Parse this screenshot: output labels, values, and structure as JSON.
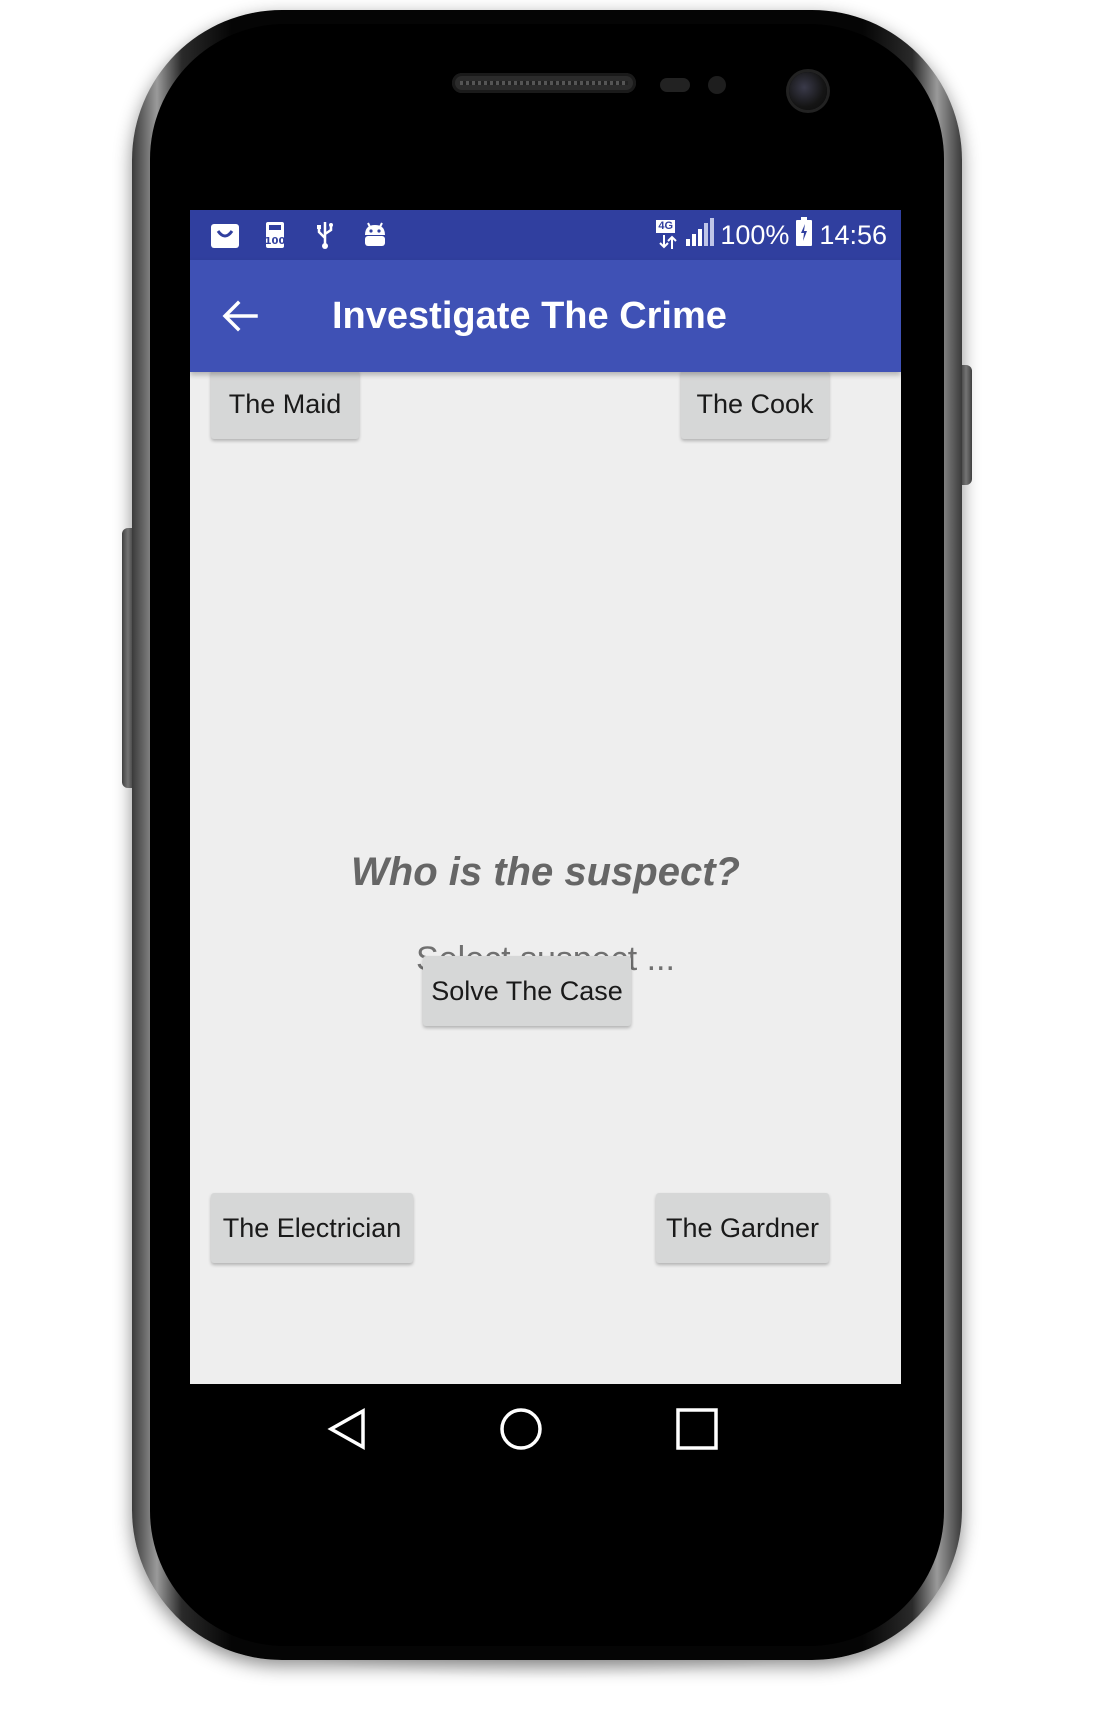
{
  "status_bar": {
    "network": "4G",
    "battery": "100%",
    "time": "14:56",
    "icons": [
      "bag-icon",
      "storage-100-icon",
      "usb-icon",
      "android-debug-icon",
      "signal-icon",
      "battery-icon"
    ]
  },
  "app_bar": {
    "title": "Investigate The Crime",
    "back_icon": "arrow-left-icon"
  },
  "suspects": {
    "maid": "The Maid",
    "cook": "The Cook",
    "electrician": "The Electrician",
    "gardner": "The Gardner"
  },
  "main": {
    "question": "Who is the suspect?",
    "selection": "Select suspect ...",
    "solve_button": "Solve The Case"
  },
  "nav_bar": {
    "icons": [
      "back-triangle-icon",
      "home-circle-icon",
      "recents-square-icon"
    ]
  },
  "colors": {
    "status_bar": "#303f9f",
    "app_bar": "#3f51b5",
    "background": "#eeeeee",
    "button": "#d6d7d7"
  }
}
